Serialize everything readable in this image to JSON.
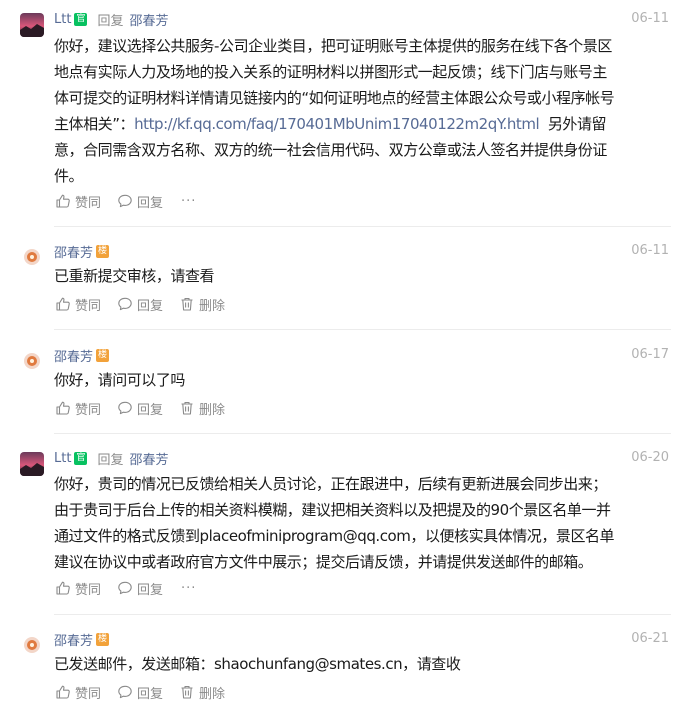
{
  "common": {
    "like_label": "赞同",
    "reply_label": "回复",
    "delete_label": "删除",
    "more": "···",
    "reply_word": "回复"
  },
  "comments": [
    {
      "author": "Ltt",
      "badge": "官",
      "badge_type": "official",
      "reply_to": "邵春芳",
      "date": "06-11",
      "lines": [
        "你好，建议选择公共服务-公司企业类目，把可证明账号主体提供的服务在线下各个景区",
        "地点有实际人力及场地的投入关系的证明材料以拼图形式一起反馈；线下门店与账号主",
        "体可提交的证明材料详情请见链接内的“如何证明地点的经营主体跟公众号或小程序帐号"
      ],
      "line4_prefix": "主体相关”：",
      "link": "http://kf.qq.com/faq/170401MbUnim17040122m2qY.html",
      "line4_suffix": "另外请留",
      "lines_after": [
        "意，合同需含双方名称、双方的统一社会信用代码、双方公章或法人签名并提供身份证",
        "件。"
      ]
    },
    {
      "author": "邵春芳",
      "badge": "楼",
      "badge_type": "author",
      "date": "06-11",
      "lines": [
        "已重新提交审核，请查看"
      ]
    },
    {
      "author": "邵春芳",
      "badge": "楼",
      "badge_type": "author",
      "date": "06-17",
      "lines": [
        "你好，请问可以了吗"
      ]
    },
    {
      "author": "Ltt",
      "badge": "官",
      "badge_type": "official",
      "reply_to": "邵春芳",
      "date": "06-20",
      "lines": [
        "你好，贵司的情况已反馈给相关人员讨论，正在跟进中，后续有更新进展会同步出来；",
        "由于贵司于后台上传的相关资料模糊，建议把相关资料以及把提及的90个景区名单一并",
        "通过文件的格式反馈到placeofminiprogram@qq.com，以便核实具体情况，景区名单",
        "建议在协议中或者政府官方文件中展示；提交后请反馈，并请提供发送邮件的邮箱。"
      ]
    },
    {
      "author": "邵春芳",
      "badge": "楼",
      "badge_type": "author",
      "date": "06-21",
      "lines": [
        "已发送邮件，发送邮箱：shaochunfang@smates.cn，请查收"
      ]
    }
  ],
  "colors": {
    "name": "#576b95",
    "official_badge": "#07c160",
    "author_badge": "#f2a23a",
    "meta": "#b2b2b2"
  }
}
